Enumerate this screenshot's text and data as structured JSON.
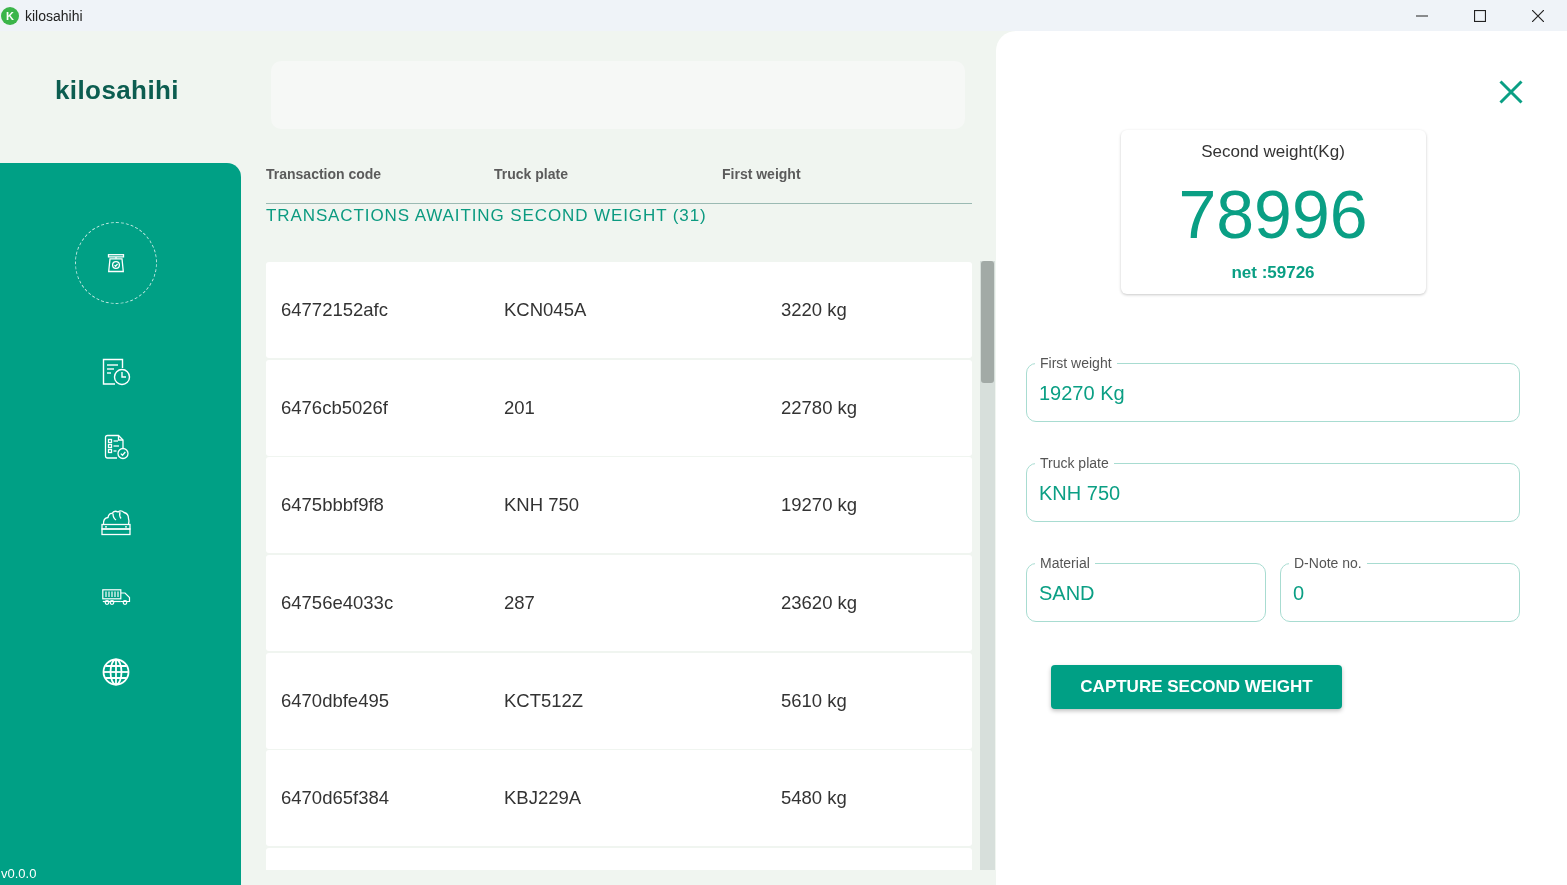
{
  "window": {
    "icon_letter": "K",
    "title": "kilosahihi"
  },
  "logo": {
    "text": "kilosahihi"
  },
  "sidebar": {
    "items": [
      {
        "selected": true
      },
      {
        "selected": false
      },
      {
        "selected": false
      },
      {
        "selected": false
      },
      {
        "selected": false
      },
      {
        "selected": false
      }
    ],
    "version": "v0.0.0"
  },
  "table": {
    "columns": [
      "Transaction code",
      "Truck plate",
      "First weight"
    ],
    "title": "TRANSACTIONS AWAITING SECOND WEIGHT (31)",
    "rows": [
      {
        "cells": [
          "64772152afc",
          "KCN045A",
          "3220 kg"
        ]
      },
      {
        "cells": [
          "6476cb5026f",
          "201",
          "22780 kg"
        ]
      },
      {
        "cells": [
          "6475bbbf9f8",
          "KNH 750",
          "19270 kg"
        ]
      },
      {
        "cells": [
          "64756e4033c",
          "287",
          "23620 kg"
        ]
      },
      {
        "cells": [
          "6470dbfe495",
          "KCT512Z",
          "5610 kg"
        ]
      },
      {
        "cells": [
          "6470d65f384",
          "KBJ229A",
          "5480 kg"
        ]
      }
    ]
  },
  "detail_panel": {
    "weight_card": {
      "label": "Second weight(Kg)",
      "value": "78996",
      "net": "net :59726"
    },
    "fields": [
      {
        "label": "First weight",
        "value": "19270 Kg"
      },
      {
        "label": "Truck plate",
        "value": "KNH 750"
      },
      {
        "label": "Material",
        "value": "SAND"
      },
      {
        "label": "D-Note no.",
        "value": "0"
      }
    ],
    "button": "CAPTURE SECOND WEIGHT"
  }
}
